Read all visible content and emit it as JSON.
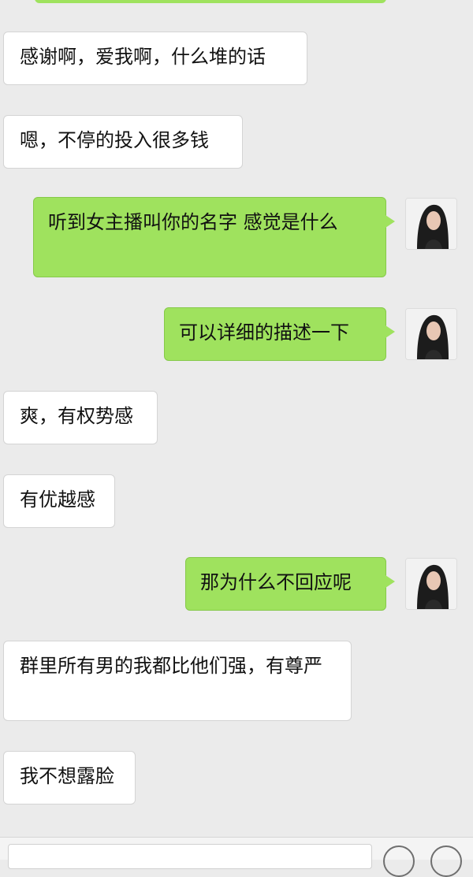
{
  "messages": [
    {
      "side": "in",
      "text": "感谢啊，爱我啊，什么堆的话"
    },
    {
      "side": "in",
      "text": "嗯，不停的投入很多钱"
    },
    {
      "side": "out",
      "text": "听到女主播叫你的名字 感觉是什么"
    },
    {
      "side": "out",
      "text": "可以详细的描述一下"
    },
    {
      "side": "in",
      "text": "爽，有权势感"
    },
    {
      "side": "in",
      "text": "有优越感"
    },
    {
      "side": "out",
      "text": "那为什么不回应呢"
    },
    {
      "side": "in",
      "text": "群里所有男的我都比他们强，有尊严"
    },
    {
      "side": "in",
      "text": "我不想露脸"
    }
  ],
  "colors": {
    "background": "#ebebeb",
    "incoming_bubble": "#ffffff",
    "outgoing_bubble": "#9fe25e"
  },
  "icons": {
    "avatar": "user-avatar-photo",
    "voice": "voice-icon",
    "emoji": "emoji-icon"
  }
}
